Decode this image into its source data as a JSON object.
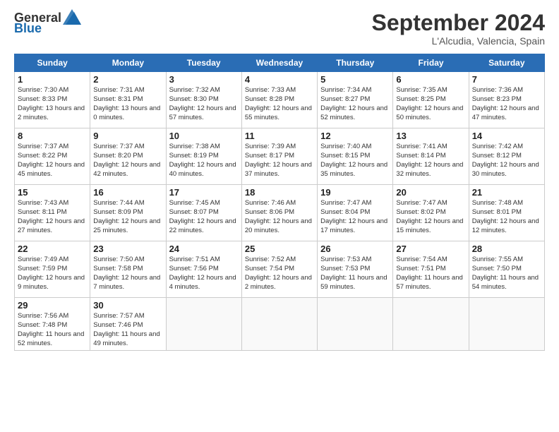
{
  "header": {
    "logo_general": "General",
    "logo_blue": "Blue",
    "month_title": "September 2024",
    "location": "L'Alcudia, Valencia, Spain"
  },
  "calendar": {
    "days_of_week": [
      "Sunday",
      "Monday",
      "Tuesday",
      "Wednesday",
      "Thursday",
      "Friday",
      "Saturday"
    ],
    "weeks": [
      [
        null,
        {
          "day": "2",
          "sunrise": "Sunrise: 7:31 AM",
          "sunset": "Sunset: 8:31 PM",
          "daylight": "Daylight: 13 hours and 0 minutes."
        },
        {
          "day": "3",
          "sunrise": "Sunrise: 7:32 AM",
          "sunset": "Sunset: 8:30 PM",
          "daylight": "Daylight: 12 hours and 57 minutes."
        },
        {
          "day": "4",
          "sunrise": "Sunrise: 7:33 AM",
          "sunset": "Sunset: 8:28 PM",
          "daylight": "Daylight: 12 hours and 55 minutes."
        },
        {
          "day": "5",
          "sunrise": "Sunrise: 7:34 AM",
          "sunset": "Sunset: 8:27 PM",
          "daylight": "Daylight: 12 hours and 52 minutes."
        },
        {
          "day": "6",
          "sunrise": "Sunrise: 7:35 AM",
          "sunset": "Sunset: 8:25 PM",
          "daylight": "Daylight: 12 hours and 50 minutes."
        },
        {
          "day": "7",
          "sunrise": "Sunrise: 7:36 AM",
          "sunset": "Sunset: 8:23 PM",
          "daylight": "Daylight: 12 hours and 47 minutes."
        }
      ],
      [
        {
          "day": "1",
          "sunrise": "Sunrise: 7:30 AM",
          "sunset": "Sunset: 8:33 PM",
          "daylight": "Daylight: 13 hours and 2 minutes."
        },
        {
          "day": "9",
          "sunrise": "Sunrise: 7:37 AM",
          "sunset": "Sunset: 8:20 PM",
          "daylight": "Daylight: 12 hours and 42 minutes."
        },
        {
          "day": "10",
          "sunrise": "Sunrise: 7:38 AM",
          "sunset": "Sunset: 8:19 PM",
          "daylight": "Daylight: 12 hours and 40 minutes."
        },
        {
          "day": "11",
          "sunrise": "Sunrise: 7:39 AM",
          "sunset": "Sunset: 8:17 PM",
          "daylight": "Daylight: 12 hours and 37 minutes."
        },
        {
          "day": "12",
          "sunrise": "Sunrise: 7:40 AM",
          "sunset": "Sunset: 8:15 PM",
          "daylight": "Daylight: 12 hours and 35 minutes."
        },
        {
          "day": "13",
          "sunrise": "Sunrise: 7:41 AM",
          "sunset": "Sunset: 8:14 PM",
          "daylight": "Daylight: 12 hours and 32 minutes."
        },
        {
          "day": "14",
          "sunrise": "Sunrise: 7:42 AM",
          "sunset": "Sunset: 8:12 PM",
          "daylight": "Daylight: 12 hours and 30 minutes."
        }
      ],
      [
        {
          "day": "8",
          "sunrise": "Sunrise: 7:37 AM",
          "sunset": "Sunset: 8:22 PM",
          "daylight": "Daylight: 12 hours and 45 minutes."
        },
        {
          "day": "16",
          "sunrise": "Sunrise: 7:44 AM",
          "sunset": "Sunset: 8:09 PM",
          "daylight": "Daylight: 12 hours and 25 minutes."
        },
        {
          "day": "17",
          "sunrise": "Sunrise: 7:45 AM",
          "sunset": "Sunset: 8:07 PM",
          "daylight": "Daylight: 12 hours and 22 minutes."
        },
        {
          "day": "18",
          "sunrise": "Sunrise: 7:46 AM",
          "sunset": "Sunset: 8:06 PM",
          "daylight": "Daylight: 12 hours and 20 minutes."
        },
        {
          "day": "19",
          "sunrise": "Sunrise: 7:47 AM",
          "sunset": "Sunset: 8:04 PM",
          "daylight": "Daylight: 12 hours and 17 minutes."
        },
        {
          "day": "20",
          "sunrise": "Sunrise: 7:47 AM",
          "sunset": "Sunset: 8:02 PM",
          "daylight": "Daylight: 12 hours and 15 minutes."
        },
        {
          "day": "21",
          "sunrise": "Sunrise: 7:48 AM",
          "sunset": "Sunset: 8:01 PM",
          "daylight": "Daylight: 12 hours and 12 minutes."
        }
      ],
      [
        {
          "day": "15",
          "sunrise": "Sunrise: 7:43 AM",
          "sunset": "Sunset: 8:11 PM",
          "daylight": "Daylight: 12 hours and 27 minutes."
        },
        {
          "day": "23",
          "sunrise": "Sunrise: 7:50 AM",
          "sunset": "Sunset: 7:58 PM",
          "daylight": "Daylight: 12 hours and 7 minutes."
        },
        {
          "day": "24",
          "sunrise": "Sunrise: 7:51 AM",
          "sunset": "Sunset: 7:56 PM",
          "daylight": "Daylight: 12 hours and 4 minutes."
        },
        {
          "day": "25",
          "sunrise": "Sunrise: 7:52 AM",
          "sunset": "Sunset: 7:54 PM",
          "daylight": "Daylight: 12 hours and 2 minutes."
        },
        {
          "day": "26",
          "sunrise": "Sunrise: 7:53 AM",
          "sunset": "Sunset: 7:53 PM",
          "daylight": "Daylight: 11 hours and 59 minutes."
        },
        {
          "day": "27",
          "sunrise": "Sunrise: 7:54 AM",
          "sunset": "Sunset: 7:51 PM",
          "daylight": "Daylight: 11 hours and 57 minutes."
        },
        {
          "day": "28",
          "sunrise": "Sunrise: 7:55 AM",
          "sunset": "Sunset: 7:50 PM",
          "daylight": "Daylight: 11 hours and 54 minutes."
        }
      ],
      [
        {
          "day": "22",
          "sunrise": "Sunrise: 7:49 AM",
          "sunset": "Sunset: 7:59 PM",
          "daylight": "Daylight: 12 hours and 9 minutes."
        },
        {
          "day": "30",
          "sunrise": "Sunrise: 7:57 AM",
          "sunset": "Sunset: 7:46 PM",
          "daylight": "Daylight: 11 hours and 49 minutes."
        },
        null,
        null,
        null,
        null,
        null
      ],
      [
        {
          "day": "29",
          "sunrise": "Sunrise: 7:56 AM",
          "sunset": "Sunset: 7:48 PM",
          "daylight": "Daylight: 11 hours and 52 minutes."
        },
        null,
        null,
        null,
        null,
        null,
        null
      ]
    ]
  }
}
